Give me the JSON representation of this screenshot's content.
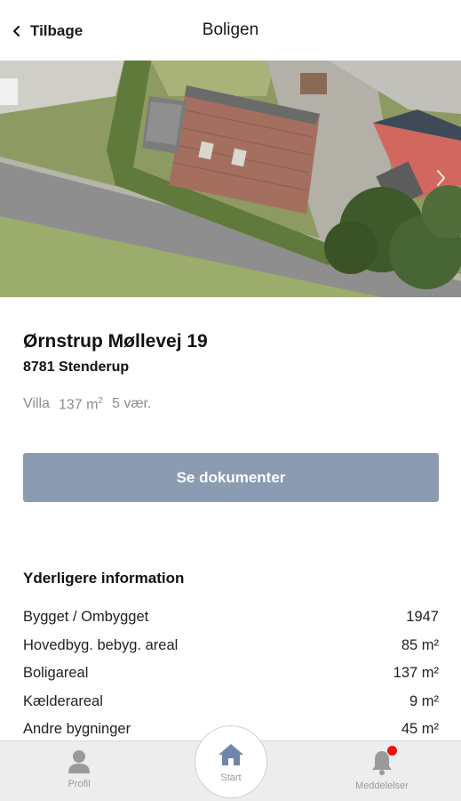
{
  "header": {
    "back_label": "Tilbage",
    "title": "Boligen"
  },
  "property": {
    "address": "Ørnstrup Møllevej 19",
    "postal": "8781 Stenderup",
    "type": "Villa",
    "area": "137 m",
    "area_unit_sup": "2",
    "rooms": "5 vær."
  },
  "documents_button": "Se dokumenter",
  "info": {
    "heading": "Yderligere information",
    "rows": [
      {
        "label": "Bygget / Ombygget",
        "value": "1947"
      },
      {
        "label": "Hovedbyg. bebyg. areal",
        "value": "85 m²"
      },
      {
        "label": "Boligareal",
        "value": "137 m²"
      },
      {
        "label": "Kælderareal",
        "value": "9 m²"
      },
      {
        "label": "Andre bygninger",
        "value": "45 m²"
      }
    ]
  },
  "tabbar": {
    "profile": "Profil",
    "start": "Start",
    "notifications": "Meddelelser"
  },
  "colors": {
    "button": "#8a9bb2",
    "icon_active": "#6f86a8",
    "icon_inactive": "#9a9a9a",
    "badge": "#ee1111"
  },
  "icons": {
    "back": "chevron-left-icon",
    "photo_next": "chevron-right-icon",
    "profile": "person-icon",
    "start": "home-icon",
    "notifications": "bell-icon"
  }
}
